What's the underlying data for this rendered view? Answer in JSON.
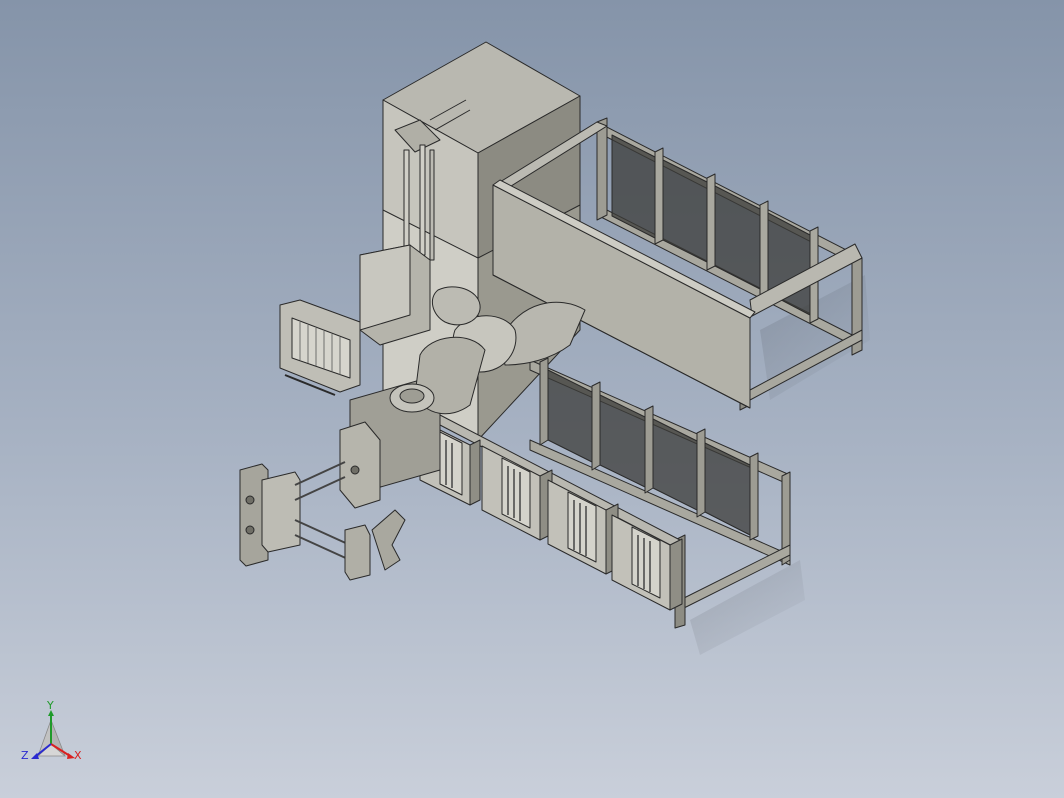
{
  "viewport": {
    "background_top": "#8594a9",
    "background_bottom": "#c9cfda"
  },
  "model": {
    "fill_light": "#c4c3bb",
    "fill_mid": "#a7a69d",
    "fill_dark": "#838278",
    "edge": "#2a2a2a"
  },
  "triad": {
    "x_label": "X",
    "y_label": "Y",
    "z_label": "Z",
    "x_color": "#d92020",
    "y_color": "#1f9a2a",
    "z_color": "#2a2ad0"
  }
}
